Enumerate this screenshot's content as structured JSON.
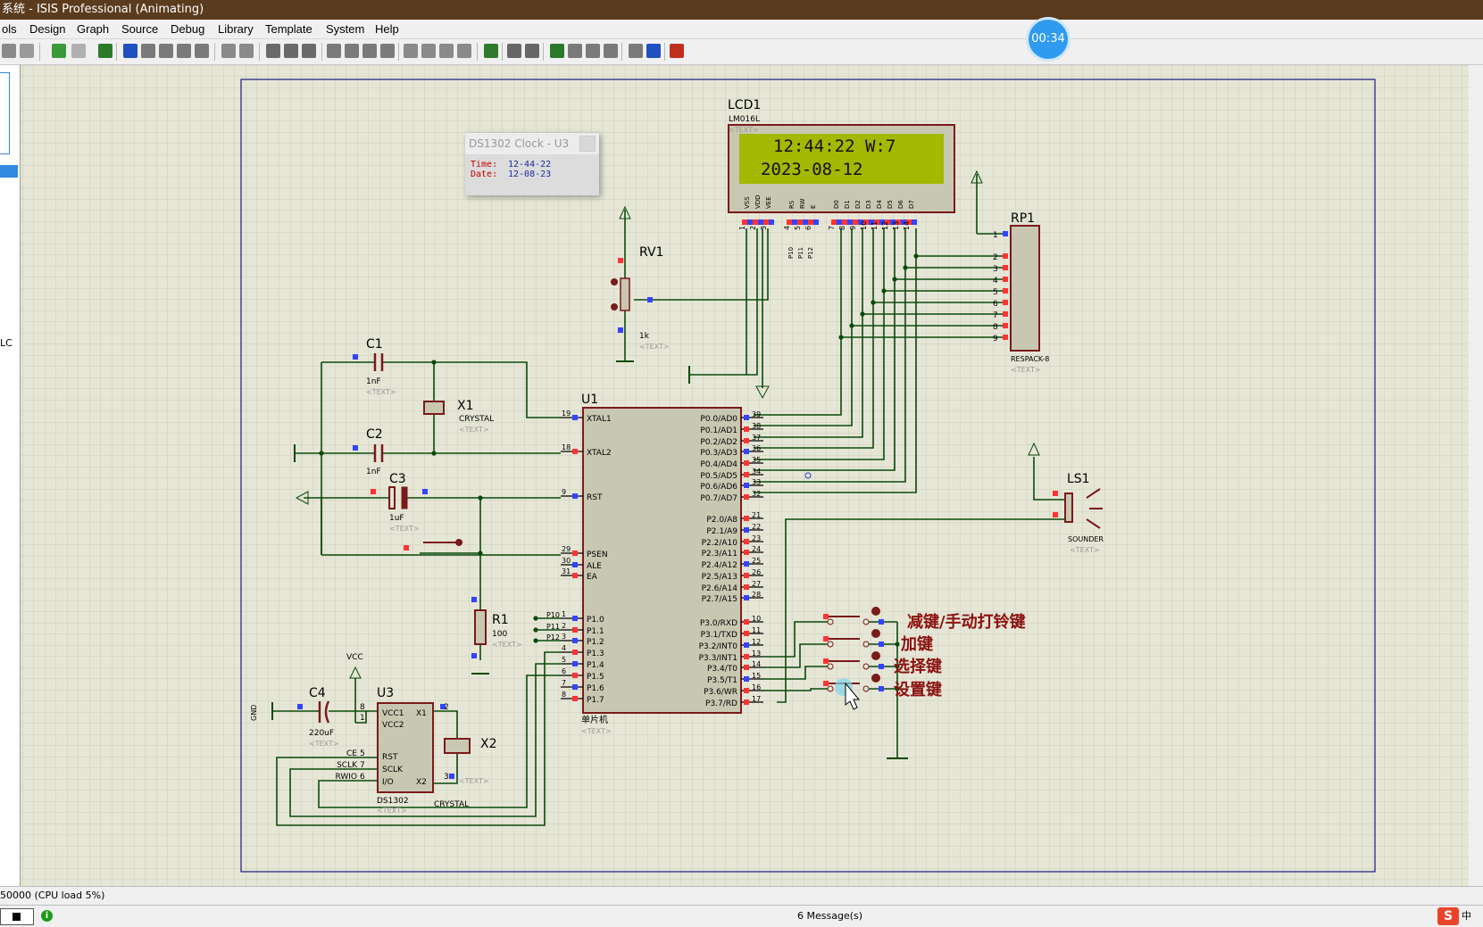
{
  "window": {
    "title": "系统 - ISIS Professional (Animating)"
  },
  "menu": [
    "ols",
    "Design",
    "Graph",
    "Source",
    "Debug",
    "Library",
    "Template",
    "System",
    "Help"
  ],
  "timer": "00:34",
  "left_pane": {
    "label": "LC"
  },
  "ds_popup": {
    "title": "DS1302 Clock - U3",
    "time_label": "Time:",
    "time_value": "12-44-22",
    "date_label": "Date:",
    "date_value": "12-08-23"
  },
  "lcd": {
    "ref": "LCD1",
    "part": "LM016L",
    "text_tag": "<TEXT>",
    "line1": "12:44:22  W:7",
    "line2": "2023-08-12",
    "pin_names": [
      "VSS",
      "VDD",
      "VEE",
      "RS",
      "RW",
      "E",
      "D0",
      "D1",
      "D2",
      "D3",
      "D4",
      "D5",
      "D6",
      "D7"
    ],
    "pin_numbers": [
      "1",
      "2",
      "3",
      "4",
      "5",
      "6",
      "7",
      "8",
      "9",
      "10",
      "11",
      "12",
      "13",
      "14"
    ],
    "ctrl_nets": [
      "P10",
      "P11",
      "P12"
    ]
  },
  "components": {
    "rv1": {
      "ref": "RV1",
      "value": "1k",
      "tag": "<TEXT>"
    },
    "c1": {
      "ref": "C1",
      "value": "1nF",
      "tag": "<TEXT>"
    },
    "c2": {
      "ref": "C2",
      "value": "1nF"
    },
    "c3": {
      "ref": "C3",
      "value": "1uF",
      "tag": "<TEXT>"
    },
    "x1": {
      "ref": "X1",
      "value": "CRYSTAL",
      "tag": "<TEXT>"
    },
    "r1": {
      "ref": "R1",
      "value": "100",
      "tag": "<TEXT>"
    },
    "c4": {
      "ref": "C4",
      "value": "220uF",
      "tag": "<TEXT>"
    },
    "u3": {
      "ref": "U3",
      "part": "DS1302",
      "tag": "<TEXT>",
      "pins_left": [
        "VCC1",
        "VCC2",
        "RST",
        "SCLK",
        "I/O"
      ],
      "pins_right": [
        "X1",
        "X2"
      ],
      "pin_nums": [
        "8",
        "1",
        "5",
        "7",
        "6",
        "2",
        "3"
      ],
      "nets": [
        "CE",
        "SCLK",
        "RWIO"
      ]
    },
    "x2": {
      "ref": "X2",
      "value": "CRYSTAL",
      "tag": "<TEXT>"
    },
    "rp1": {
      "ref": "RP1",
      "part": "RESPACK-8",
      "tag": "<TEXT>",
      "pins": [
        "1",
        "2",
        "3",
        "4",
        "5",
        "6",
        "7",
        "8",
        "9"
      ]
    },
    "ls1": {
      "ref": "LS1",
      "part": "SOUNDER",
      "tag": "<TEXT>"
    },
    "vcc_label": "VCC",
    "gnd_label": "GND"
  },
  "mcu": {
    "ref": "U1",
    "part": "单片机",
    "tag": "<TEXT>",
    "left_pins": [
      {
        "num": "19",
        "name": "XTAL1"
      },
      {
        "num": "18",
        "name": "XTAL2"
      },
      {
        "num": "9",
        "name": "RST"
      },
      {
        "num": "29",
        "name": "PSEN"
      },
      {
        "num": "30",
        "name": "ALE"
      },
      {
        "num": "31",
        "name": "EA"
      },
      {
        "num": "1",
        "name": "P1.0",
        "net": "P10"
      },
      {
        "num": "2",
        "name": "P1.1",
        "net": "P11"
      },
      {
        "num": "3",
        "name": "P1.2",
        "net": "P12"
      },
      {
        "num": "4",
        "name": "P1.3"
      },
      {
        "num": "5",
        "name": "P1.4"
      },
      {
        "num": "6",
        "name": "P1.5"
      },
      {
        "num": "7",
        "name": "P1.6"
      },
      {
        "num": "8",
        "name": "P1.7"
      }
    ],
    "right_pins": [
      {
        "num": "39",
        "name": "P0.0/AD0"
      },
      {
        "num": "38",
        "name": "P0.1/AD1"
      },
      {
        "num": "37",
        "name": "P0.2/AD2"
      },
      {
        "num": "36",
        "name": "P0.3/AD3"
      },
      {
        "num": "35",
        "name": "P0.4/AD4"
      },
      {
        "num": "34",
        "name": "P0.5/AD5"
      },
      {
        "num": "33",
        "name": "P0.6/AD6"
      },
      {
        "num": "32",
        "name": "P0.7/AD7"
      },
      {
        "num": "21",
        "name": "P2.0/A8"
      },
      {
        "num": "22",
        "name": "P2.1/A9"
      },
      {
        "num": "23",
        "name": "P2.2/A10"
      },
      {
        "num": "24",
        "name": "P2.3/A11"
      },
      {
        "num": "25",
        "name": "P2.4/A12"
      },
      {
        "num": "26",
        "name": "P2.5/A13"
      },
      {
        "num": "27",
        "name": "P2.6/A14"
      },
      {
        "num": "28",
        "name": "P2.7/A15"
      },
      {
        "num": "10",
        "name": "P3.0/RXD"
      },
      {
        "num": "11",
        "name": "P3.1/TXD"
      },
      {
        "num": "12",
        "name": "P3.2/INT0"
      },
      {
        "num": "13",
        "name": "P3.3/INT1"
      },
      {
        "num": "14",
        "name": "P3.4/T0"
      },
      {
        "num": "15",
        "name": "P3.5/T1"
      },
      {
        "num": "16",
        "name": "P3.6/WR"
      },
      {
        "num": "17",
        "name": "P3.7/RD"
      }
    ]
  },
  "buttons": [
    "减键/手动打铃键",
    "加键",
    "选择键",
    "设置键"
  ],
  "status": {
    "line1": "50000 (CPU load 5%)",
    "messages": "6 Message(s)",
    "ime_text": "中"
  },
  "colors": {
    "grid_bg": "#e6e6d6",
    "grid_line": "#cdcdbf",
    "wire": "#0a4a0a",
    "component": "#7a1a1a",
    "pin_red": "#ff3333",
    "pin_blue": "#3344ff",
    "lcd_screen": "#a3b800",
    "chip_fill": "#c8c8b2",
    "label_red": "#8b1010"
  }
}
